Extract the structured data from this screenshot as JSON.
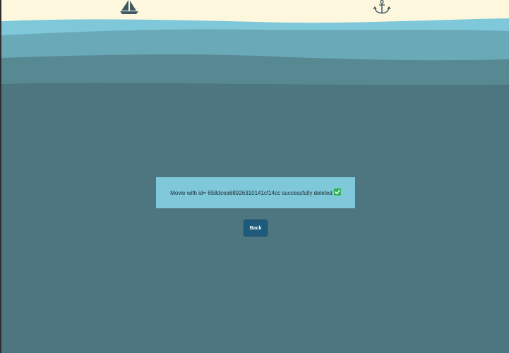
{
  "header": {
    "left_icon": "sailboat-icon",
    "right_icon": "anchor-icon"
  },
  "message": {
    "text": "Movie with id= 658dcea68926310141cf14cc successfully deleted",
    "status_icon": "check-icon",
    "status_color": "#2fb457"
  },
  "actions": {
    "back_label": "Back"
  },
  "colors": {
    "sky": "#fdf7de",
    "wave_light": "#7ec8d9",
    "wave_mid": "#6aa9b8",
    "wave_dark": "#578992",
    "deep": "#4e7680",
    "button": "#1e5a7a",
    "message_bg": "#7ec8d9"
  }
}
